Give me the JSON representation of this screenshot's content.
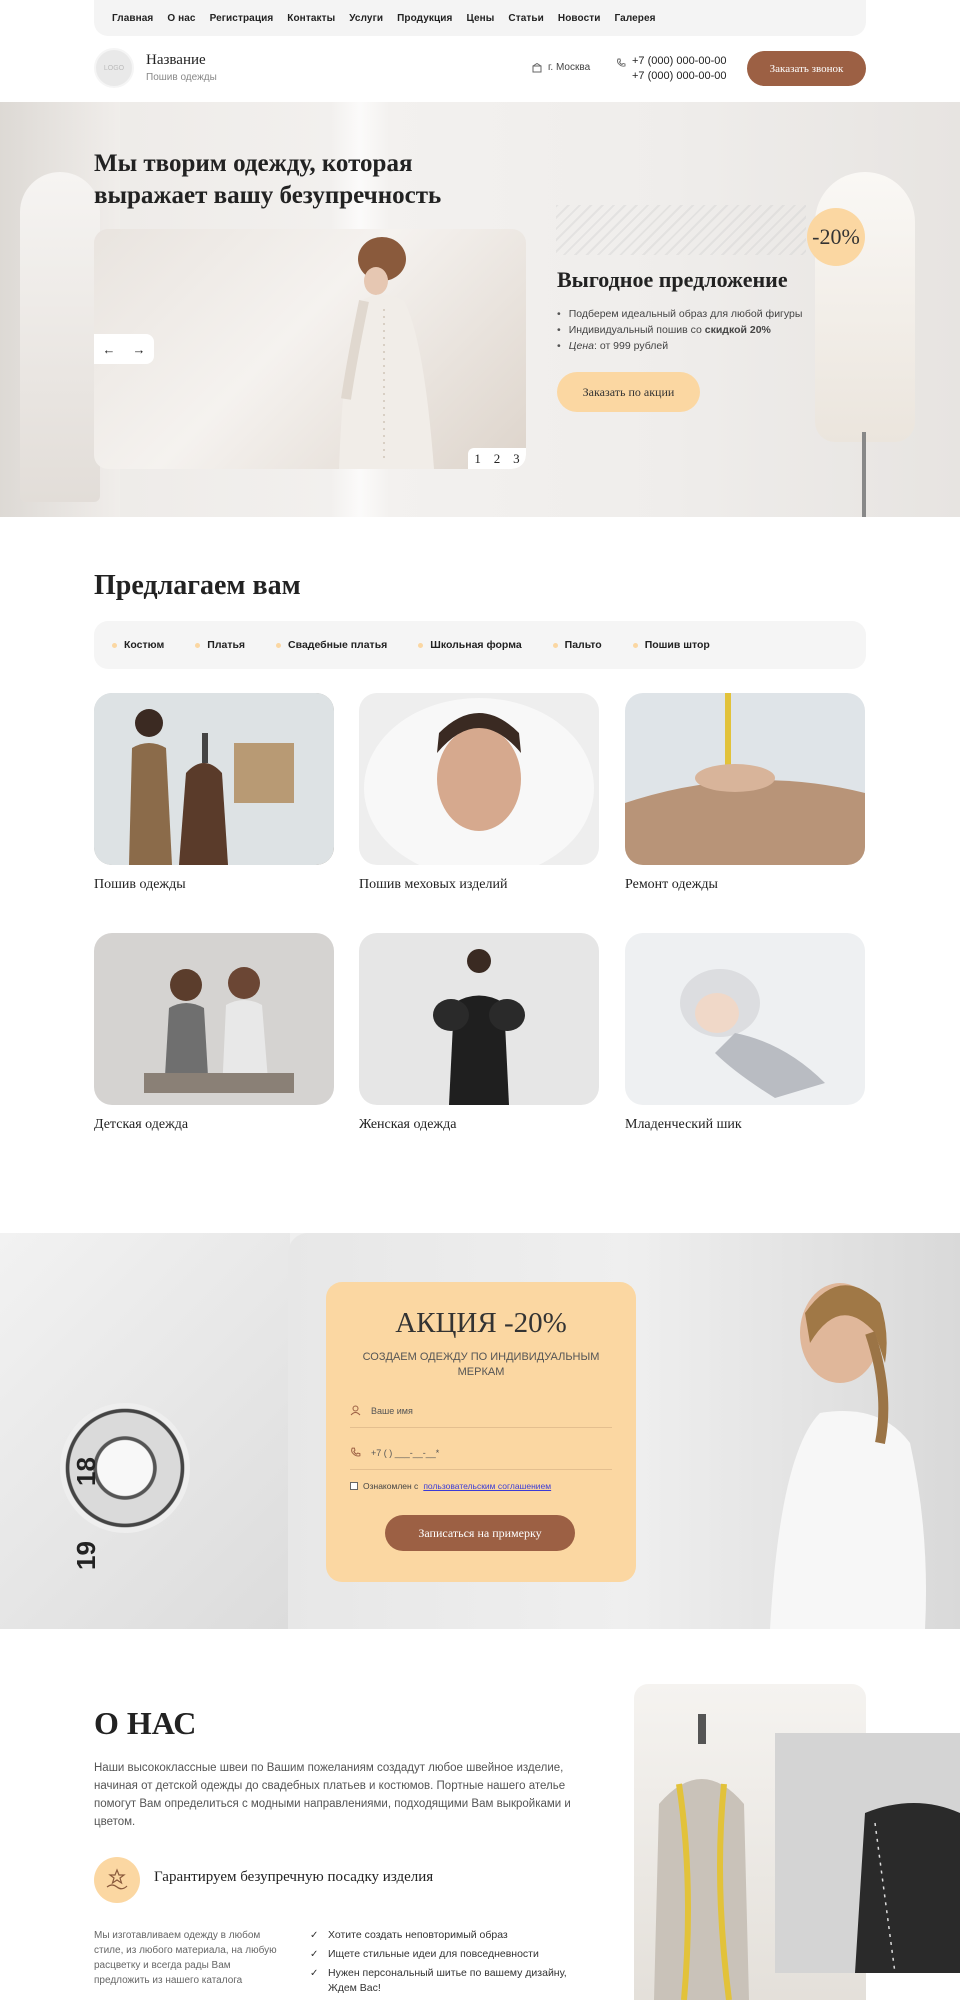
{
  "nav": [
    "Главная",
    "О нас",
    "Регистрация",
    "Контакты",
    "Услуги",
    "Продукция",
    "Цены",
    "Статьи",
    "Новости",
    "Галерея"
  ],
  "header": {
    "logo_text": "LOGO",
    "brand_name": "Название",
    "brand_sub": "Пошив одежды",
    "city": "г. Москва",
    "phone1": "+7 (000) 000-00-00",
    "phone2": "+7 (000) 000-00-00",
    "call_button": "Заказать звонок"
  },
  "hero": {
    "title": "Мы творим одежду, которая выражает вашу безупречность",
    "slider_prev": "←",
    "slider_next": "→",
    "slides": [
      "1",
      "2",
      "3"
    ],
    "discount": "-20%",
    "offer_title": "Выгодное предложение",
    "offer_items": [
      "Подберем идеальный образ для любой фигуры",
      "Индивидуальный пошив со ",
      "скидкой 20%",
      "Цена",
      ": от 999 рублей"
    ],
    "offer_button": "Заказать по акции"
  },
  "offer_section": {
    "title": "Предлагаем вам",
    "tabs": [
      "Костюм",
      "Платья",
      "Свадебные платья",
      "Школьная форма",
      "Пальто",
      "Пошив штор"
    ],
    "cards": [
      "Пошив одежды",
      "Пошив меховых изделий",
      "Ремонт одежды",
      "Детская одежда",
      "Женская одежда",
      "Младенческий шик"
    ]
  },
  "promo": {
    "title": "АКЦИЯ -20%",
    "subtitle": "СОЗДАЕМ ОДЕЖДУ ПО ИНДИВИДУАЛЬНЫМ МЕРКАМ",
    "name_placeholder": "Ваше имя",
    "phone_placeholder": "+7 (   ) ___-__-__*",
    "agree_text": "Ознакомлен с ",
    "agree_link": "пользовательским соглашением",
    "button": "Записаться на примерку",
    "tape_numbers": [
      "18",
      "19"
    ]
  },
  "about": {
    "title": "О НАС",
    "text": "Наши высококлассные швеи по Вашим пожеланиям создадут любое швейное изделие, начиная от детской одежды до свадебных платьев и костюмов. Портные нашего ателье помогут Вам определиться с модными направлениями, подходящими Вам выкройками и цветом.",
    "guarantee": "Гарантируем безупречную посадку изделия",
    "small_text": "Мы изготавливаем одежду в любом стиле, из любого материала, на любую расцветку и всегда рады Вам предложить из нашего каталога",
    "checks": [
      "Хотите создать неповторимый образ",
      "Ищете стильные идеи для повседневности",
      "Нужен персональный шитье по вашему дизайну, Ждем Вас!"
    ]
  },
  "colors": {
    "accent": "#9c6044",
    "peach": "#fbd7a2",
    "light": "#f5f5f5"
  },
  "icons": [
    "home-icon",
    "phone-icon",
    "arrow-left-icon",
    "arrow-right-icon",
    "user-icon",
    "check-icon",
    "hand-star-icon"
  ]
}
